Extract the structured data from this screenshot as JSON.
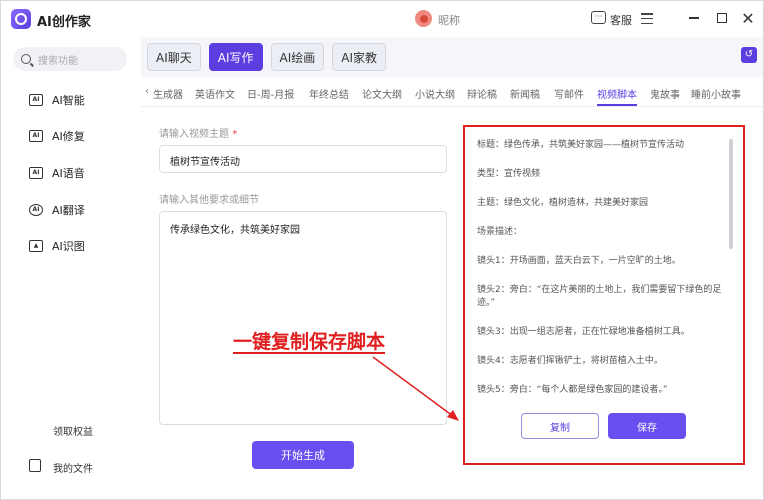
{
  "app": {
    "title": "AI创作家",
    "nickname": "昵称",
    "customer_service": "客服",
    "close_glyph": "✕"
  },
  "sidebar": {
    "search_placeholder": "搜索功能",
    "items": [
      {
        "label": "AI智能",
        "icon": "ai-chip-icon"
      },
      {
        "label": "AI修复",
        "icon": "image-repair-icon"
      },
      {
        "label": "AI语音",
        "icon": "voice-icon"
      },
      {
        "label": "AI翻译",
        "icon": "translate-icon"
      },
      {
        "label": "AI识图",
        "icon": "image-recognize-icon"
      }
    ],
    "claim_rights": "领取权益",
    "my_files": "我的文件"
  },
  "tabs": [
    {
      "label": "AI聊天",
      "active": false
    },
    {
      "label": "AI写作",
      "active": true
    },
    {
      "label": "AI绘画",
      "active": false
    },
    {
      "label": "AI家教",
      "active": false
    }
  ],
  "subnav": {
    "left_fragment": "生成器",
    "items": [
      "英语作文",
      "日-周-月报",
      "年终总结",
      "论文大纲",
      "小说大纲",
      "辩论稿",
      "新闻稿",
      "写邮件",
      "视频脚本",
      "鬼故事",
      "睡前小故事"
    ],
    "active": "视频脚本"
  },
  "form": {
    "topic_label": "请输入视频主题",
    "topic_required": "*",
    "topic_value": "植树节宣传活动",
    "details_label": "请输入其他要求或细节",
    "details_value": "传承绿色文化，共筑美好家园",
    "generate_button": "开始生成"
  },
  "result": {
    "lines": [
      "标题：绿色传承，共筑美好家园——植树节宣传活动",
      "类型：宣传视频",
      "主题：绿色文化，植树造林，共建美好家园",
      "场景描述：",
      "镜头1：开场画面，蓝天白云下，一片空旷的土地。",
      "镜头2：旁白：“在这片美丽的土地上，我们需要留下绿色的足迹。”",
      "镜头3：出现一组志愿者，正在忙碌地准备植树工具。",
      "镜头4：志愿者们挥锹铲土，将树苗植入土中。",
      "镜头5：旁白：“每个人都是绿色家园的建设者。”"
    ],
    "copy_button": "复制",
    "save_button": "保存"
  },
  "annotation": "一键复制保存脚本",
  "colors": {
    "brand": "#5b3de0",
    "highlight": "#e02020"
  }
}
